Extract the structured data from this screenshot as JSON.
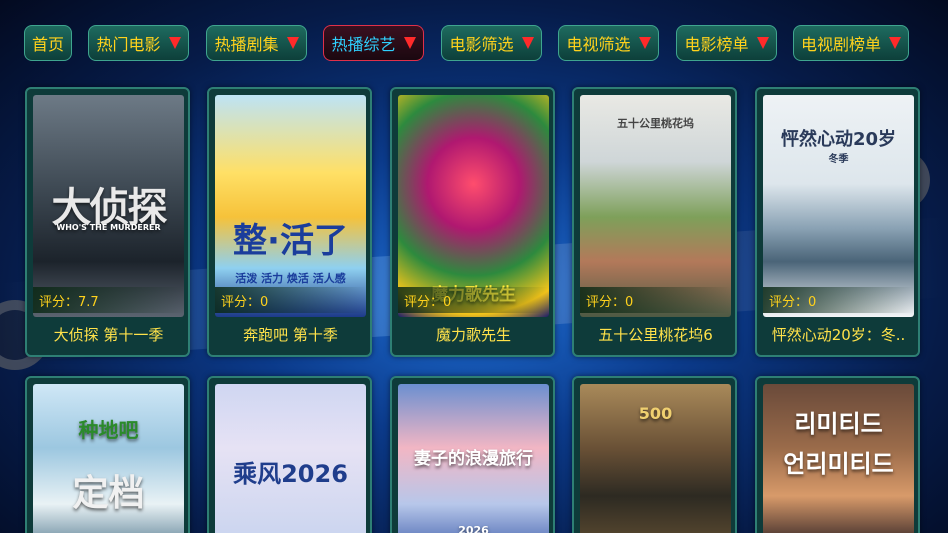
{
  "nav": {
    "items": [
      {
        "label": "首页",
        "has_arrow": false,
        "active": false
      },
      {
        "label": "热门电影",
        "has_arrow": true,
        "active": false
      },
      {
        "label": "热播剧集",
        "has_arrow": true,
        "active": false
      },
      {
        "label": "热播综艺",
        "has_arrow": true,
        "active": true
      },
      {
        "label": "电影筛选",
        "has_arrow": true,
        "active": false
      },
      {
        "label": "电视筛选",
        "has_arrow": true,
        "active": false
      },
      {
        "label": "电影榜单",
        "has_arrow": true,
        "active": false
      },
      {
        "label": "电视剧榜单",
        "has_arrow": true,
        "active": false
      }
    ]
  },
  "grid": {
    "row1": [
      {
        "title": "大侦探 第十一季",
        "score": "评分：7.7",
        "poster_text": "大侦探",
        "poster_sub": "WHO'S THE MURDERER"
      },
      {
        "title": "奔跑吧 第十季",
        "score": "评分：0",
        "poster_text": "整·活了",
        "poster_sub": "活泼 活力 焕活 活人感"
      },
      {
        "title": "魔力歌先生",
        "score": "评分：0",
        "poster_text": "魔力歌先生",
        "poster_sub": ""
      },
      {
        "title": "五十公里桃花坞6",
        "score": "评分：0",
        "poster_text": "五十公里桃花坞",
        "poster_sub": ""
      },
      {
        "title": "怦然心动20岁：冬..",
        "score": "评分：0",
        "poster_text": "怦然心动20岁",
        "poster_sub": "冬季"
      }
    ],
    "row2": [
      {
        "poster_text": "种地吧",
        "poster_sub": "定档"
      },
      {
        "poster_text": "乘风2026",
        "poster_sub": ""
      },
      {
        "poster_text": "妻子的浪漫旅行",
        "poster_sub": "2026"
      },
      {
        "poster_text": "500",
        "poster_sub": ""
      },
      {
        "poster_text": "리미티드",
        "poster_sub": "언리미티드"
      }
    ]
  }
}
